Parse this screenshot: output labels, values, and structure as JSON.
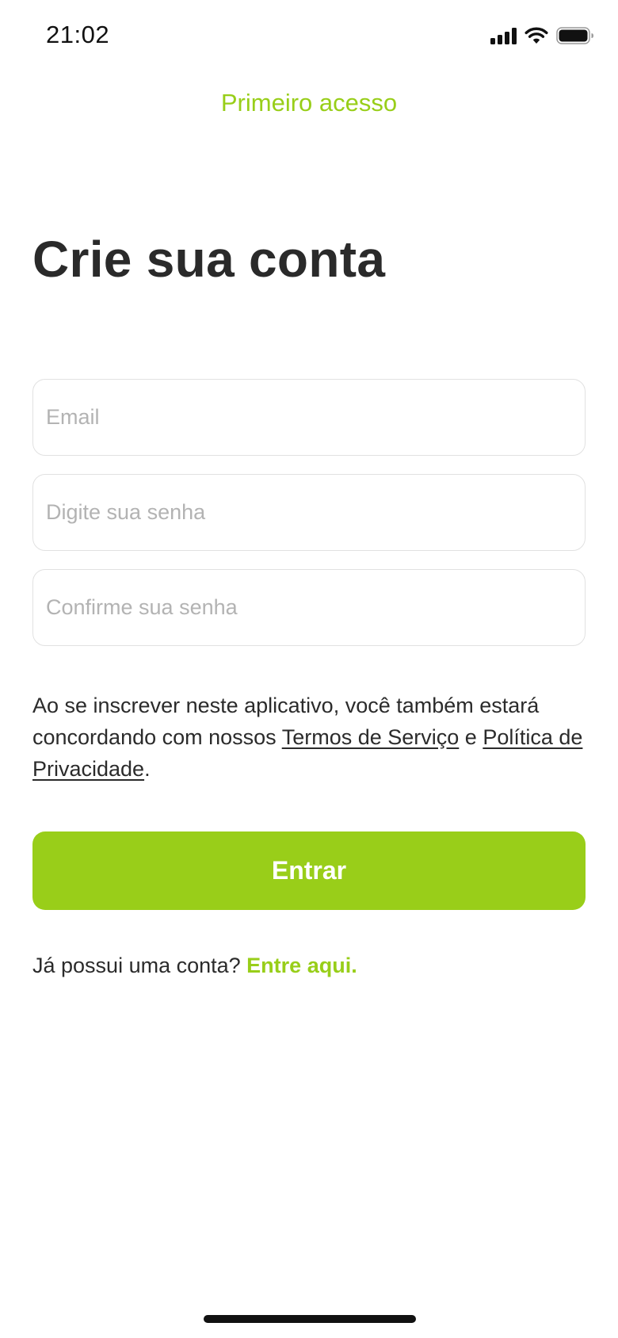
{
  "status_bar": {
    "time": "21:02",
    "icons": [
      "cellular-signal-icon",
      "wifi-icon",
      "battery-icon"
    ]
  },
  "nav": {
    "title": "Primeiro acesso"
  },
  "heading": "Crie sua conta",
  "form": {
    "email_placeholder": "Email",
    "email_value": "",
    "password_placeholder": "Digite sua senha",
    "password_value": "",
    "confirm_placeholder": "Confirme sua senha",
    "confirm_value": ""
  },
  "terms": {
    "prefix": "Ao se inscrever neste aplicativo, você também estará concordando com nossos ",
    "terms_link": "Termos de Serviço",
    "connector": " e ",
    "privacy_link": "Política de Privacidade",
    "suffix": "."
  },
  "submit_label": "Entrar",
  "login": {
    "question": "Já possui uma conta? ",
    "link": "Entre aqui."
  },
  "colors": {
    "accent": "#98ce19",
    "text": "#2b2b2b",
    "placeholder": "#b3b3b3",
    "field_border": "#e1e1e1"
  }
}
